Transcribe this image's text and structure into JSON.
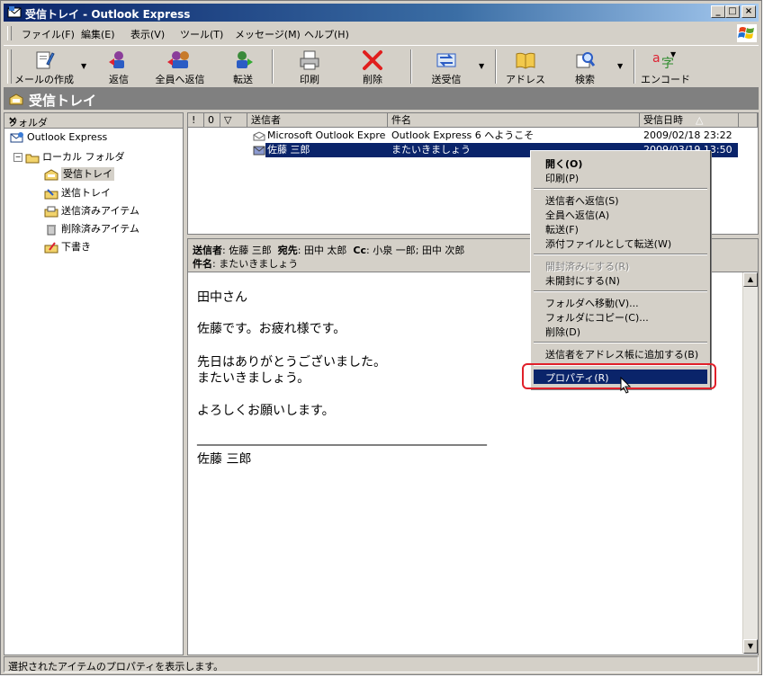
{
  "window": {
    "title": "受信トレイ - Outlook Express",
    "min": "_",
    "max": "□",
    "close": "×"
  },
  "menu": [
    "ファイル(F)",
    "編集(E)",
    "表示(V)",
    "ツール(T)",
    "メッセージ(M)",
    "ヘルプ(H)"
  ],
  "toolbar": {
    "compose": "メールの作成",
    "reply": "返信",
    "reply_all": "全員へ返信",
    "forward": "転送",
    "print": "印刷",
    "delete": "削除",
    "send_receive": "送受信",
    "addresses": "アドレス",
    "find": "検索",
    "encoding": "エンコード"
  },
  "folder_bar": {
    "title": "受信トレイ"
  },
  "folders": {
    "header": "フォルダ",
    "close": "×",
    "root": "Outlook Express",
    "local": "ローカル フォルダ",
    "inbox": "受信トレイ",
    "outbox": "送信トレイ",
    "sent": "送信済みアイテム",
    "deleted": "削除済みアイテム",
    "drafts": "下書き"
  },
  "list": {
    "columns": {
      "priority": "!",
      "attach": "0",
      "flag": "▽",
      "from": "送信者",
      "subject": "件名",
      "received": "受信日時"
    },
    "rows": [
      {
        "from": "Microsoft Outlook Expre...",
        "subject": "Outlook Express 6 へようこそ",
        "received": "2009/02/18 23:22"
      },
      {
        "from": "佐藤 三郎",
        "subject": "またいきましょう",
        "received": "2009/03/19 13:50"
      }
    ]
  },
  "preview": {
    "from_label": "送信者",
    "from": "佐藤 三郎",
    "to_label": "宛先",
    "to": "田中 太郎",
    "cc_label": "Cc",
    "cc": "小泉 一郎; 田中 次郎",
    "subject_label": "件名",
    "subject": "またいきましょう",
    "body": [
      "田中さん",
      "佐藤です。お疲れ様です。",
      "先日はありがとうございました。",
      "またいきましょう。",
      "よろしくお願いします。",
      "______________________________________________",
      "佐藤 三郎"
    ]
  },
  "context_menu": {
    "open": "開く(O)",
    "print": "印刷(P)",
    "reply_sender": "送信者へ返信(S)",
    "reply_all": "全員へ返信(A)",
    "forward": "転送(F)",
    "forward_attach": "添付ファイルとして転送(W)",
    "mark_read": "開封済みにする(R)",
    "mark_unread": "未開封にする(N)",
    "move": "フォルダへ移動(V)...",
    "copy": "フォルダにコピー(C)...",
    "delete": "削除(D)",
    "add_sender": "送信者をアドレス帳に追加する(B)",
    "properties": "プロパティ(R)"
  },
  "status": {
    "text": "選択されたアイテムのプロパティを表示します。"
  },
  "colors": {
    "title_start": "#0a246a",
    "title_end": "#a6caf0",
    "highlight": "#0a246a",
    "annotation": "#e0202a",
    "chrome": "#d4d0c8"
  }
}
